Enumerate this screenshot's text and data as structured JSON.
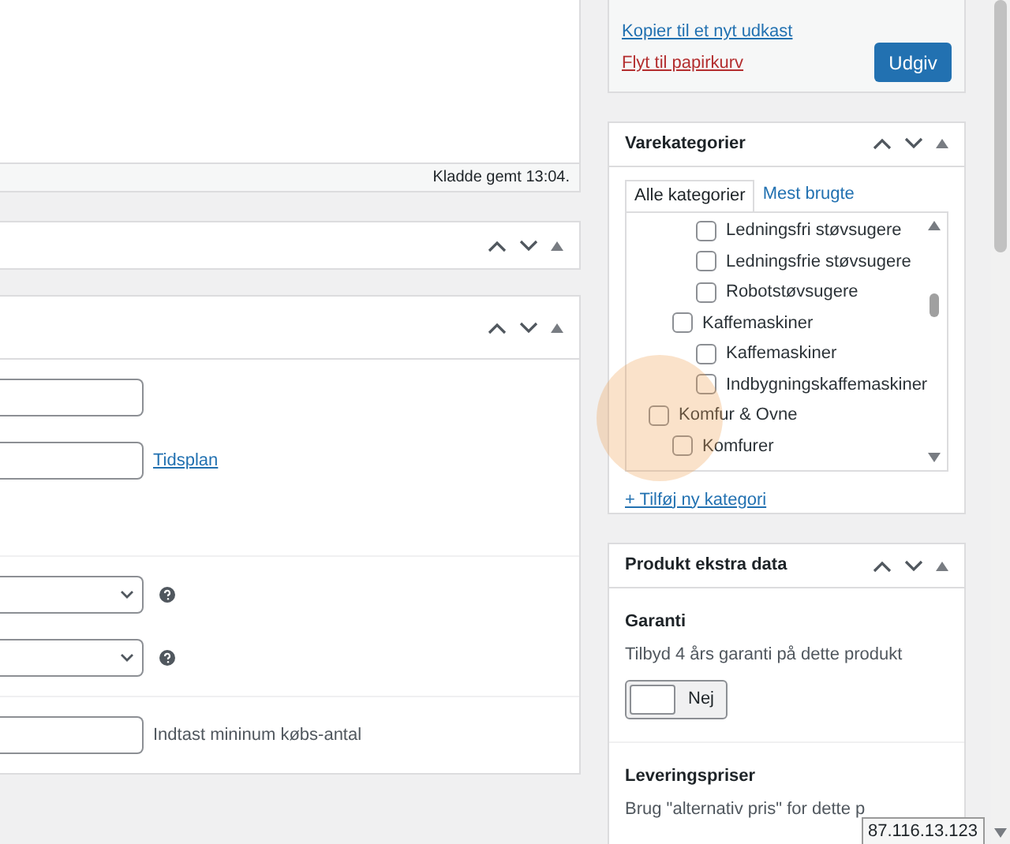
{
  "editor": {
    "status": "Kladde gemt 13:04."
  },
  "fields": {
    "inputs": [
      {
        "link": "Tidsplan"
      }
    ],
    "selects": [
      {
        "kind": "select_with_help"
      },
      {
        "kind": "select_with_help"
      }
    ],
    "min_qty": {
      "hint": "Indtast mininum købs-antal"
    }
  },
  "publish": {
    "copy_link": "Kopier til et nyt udkast",
    "trash_link": "Flyt til papirkurv",
    "button": "Udgiv"
  },
  "categories": {
    "title": "Varekategorier",
    "tabs": [
      {
        "label": "Alle kategorier",
        "selected": true
      },
      {
        "label": "Mest brugte",
        "selected": false
      }
    ],
    "items": [
      {
        "children": [
          {
            "children": [
              {
                "label": "Ledningsfri støvsugere",
                "checked": false
              },
              {
                "label": "Ledningsfrie støvsugere",
                "checked": false
              },
              {
                "label": "Robotstøvsugere",
                "checked": false
              }
            ]
          },
          {
            "label": "Kaffemaskiner",
            "checked": false,
            "children": [
              {
                "label": "Kaffemaskiner",
                "checked": false
              },
              {
                "label": "Indbygningskaffemaskiner",
                "checked": false
              }
            ]
          }
        ]
      },
      {
        "label": "Komfur & Ovne",
        "checked": false,
        "children": [
          {
            "label": "Komfurer",
            "checked": false
          }
        ]
      }
    ],
    "add_link": "+ Tilføj ny kategori"
  },
  "extra": {
    "title": "Produkt ekstra data",
    "sections": [
      {
        "heading": "Garanti",
        "text": "Tilbyd 4 års garanti på dette produkt",
        "toggle": {
          "on": false,
          "label": "Nej"
        }
      },
      {
        "heading": "Leveringspriser",
        "text": "Brug \"alternativ pris\" for dette p"
      }
    ]
  },
  "tooltip": "87.116.13.123"
}
